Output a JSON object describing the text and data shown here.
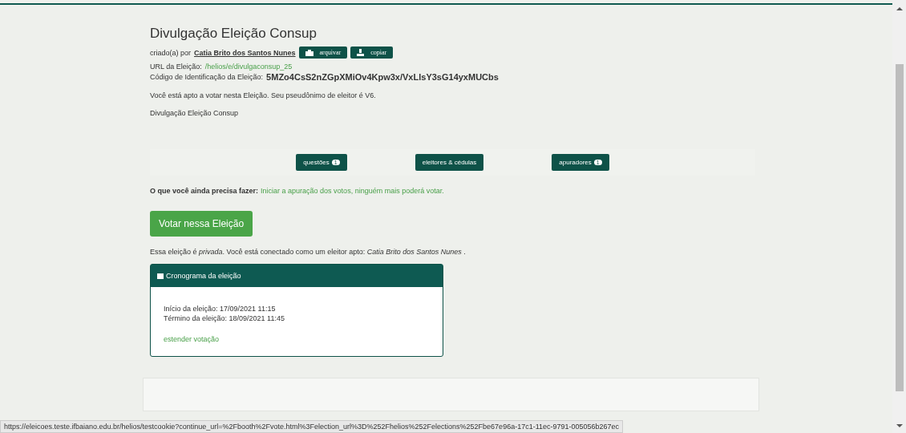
{
  "election": {
    "title": "Divulgação Eleição Consup",
    "created_by_label": "criado(a) por",
    "creator": "Catia Brito dos Santos Nunes",
    "actions": [
      {
        "label": "arquivar",
        "kind": "archive"
      },
      {
        "label": "copiar",
        "kind": "copy"
      }
    ],
    "url_label": "URL da Eleição:",
    "url": "/helios/e/divulgaconsup_25",
    "code_label": "Código de Identificação da Eleição:",
    "code": "5MZo4CsS2nZGpXMiOv4Kpw3x/VxLlsY3sG14yxMUCbs",
    "eligibility": "Você está apto a votar nesta Eleição. Seu pseudônimo de eleitor é V6.",
    "description": "Divulgação Eleição Consup"
  },
  "tabs": [
    {
      "label": "questões",
      "badge": "1"
    },
    {
      "label": "eleitores & cédulas"
    },
    {
      "label": "apuradores",
      "badge": "1"
    }
  ],
  "todo": {
    "label": "O que você ainda precisa fazer:",
    "link": "Iniciar a apuração dos votos, ninguém mais poderá votar."
  },
  "vote_button": "Votar nessa Eleição",
  "privacy_note": "Essa eleição é *privada*. Você está conectado como um eleitor apto: *Catia Brito dos Santos Nunes* .",
  "schedule": {
    "title": "Cronograma da eleição",
    "lines": [
      "Início da eleição: 17/09/2021 11:15",
      "Término da eleição: 18/09/2021 11:45"
    ],
    "link": "estender votação"
  },
  "status_bar": "https://eleicoes.teste.ifbaiano.edu.br/helios/testcookie?continue_url=%2Fbooth%2Fvote.html%3Felection_url%3D%252Fhelios%252Felections%252Fbe67e96a-17c1-11ec-9791-005056b267ec"
}
